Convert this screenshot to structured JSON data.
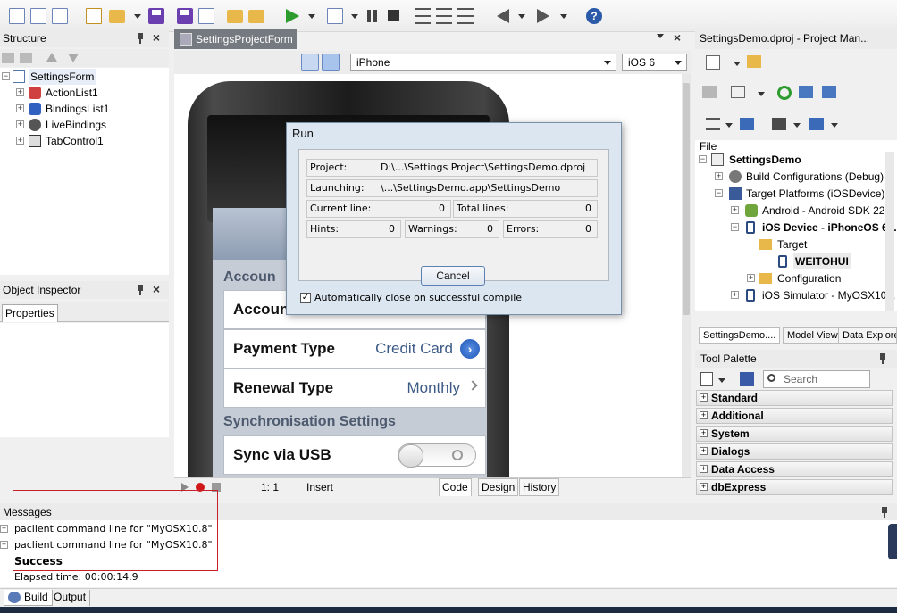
{
  "toolbar": {
    "help_label": "?"
  },
  "structure": {
    "title": "Structure",
    "tree": [
      {
        "label": "SettingsForm",
        "depth": 0
      },
      {
        "label": "ActionList1",
        "depth": 1
      },
      {
        "label": "BindingsList1",
        "depth": 1
      },
      {
        "label": "LiveBindings",
        "depth": 1
      },
      {
        "label": "TabControl1",
        "depth": 1
      }
    ]
  },
  "object_inspector": {
    "title": "Object Inspector",
    "tab": "Properties"
  },
  "designer": {
    "tab_title": "SettingsProjectForm",
    "device": "iPhone",
    "os": "iOS 6",
    "ios": {
      "section1": "Accoun",
      "row_account": "Accoun",
      "payment_label": "Payment Type",
      "payment_value": "Credit Card",
      "renewal_label": "Renewal Type",
      "renewal_value": "Monthly",
      "section2": "Synchronisation Settings",
      "sync_label": "Sync via USB",
      "sync_toggle": "O"
    }
  },
  "run_dialog": {
    "title": "Run",
    "project_label": "Project:",
    "project_value": "D:\\...\\Settings Project\\SettingsDemo.dproj",
    "launching_label": "Launching:",
    "launching_value": "\\...\\SettingsDemo.app\\SettingsDemo",
    "current_line_label": "Current line:",
    "current_line_value": "0",
    "total_lines_label": "Total lines:",
    "total_lines_value": "0",
    "hints_label": "Hints:",
    "hints_value": "0",
    "warnings_label": "Warnings:",
    "warnings_value": "0",
    "errors_label": "Errors:",
    "errors_value": "0",
    "cancel_label": "Cancel",
    "autoclose_label": "Automatically close on successful compile",
    "autoclose_checked": true
  },
  "editor_status": {
    "position": "1:  1",
    "mode": "Insert",
    "tabs": [
      "Code",
      "Design",
      "History"
    ]
  },
  "project_manager": {
    "title": "SettingsDemo.dproj - Project Man...",
    "header": "File",
    "tree": [
      {
        "label": "SettingsDemo",
        "bold": true
      },
      {
        "label": "Build Configurations (Debug)",
        "bold": false
      },
      {
        "label": "Target Platforms (iOSDevice)",
        "bold": false
      },
      {
        "label": "Android - Android SDK 22...",
        "bold": false
      },
      {
        "label": "iOS Device - iPhoneOS 6...",
        "bold": true
      },
      {
        "label": "Target",
        "bold": false
      },
      {
        "label": "WEITOHUI",
        "bold": true
      },
      {
        "label": "Configuration",
        "bold": false
      },
      {
        "label": "iOS Simulator - MyOSX10...",
        "bold": false
      }
    ],
    "tabs": [
      "SettingsDemo....",
      "Model View",
      "Data Explore"
    ]
  },
  "tool_palette": {
    "title": "Tool Palette",
    "search_placeholder": "Search",
    "categories": [
      "Standard",
      "Additional",
      "System",
      "Dialogs",
      "Data Access",
      "dbExpress"
    ]
  },
  "messages": {
    "title": "Messages",
    "rows": [
      "paclient command line for \"MyOSX10.8\"",
      "paclient command line for \"MyOSX10.8\""
    ],
    "success": "Success",
    "elapsed": "Elapsed time: 00:00:14.9",
    "tabs": [
      "Build",
      "Output"
    ]
  }
}
